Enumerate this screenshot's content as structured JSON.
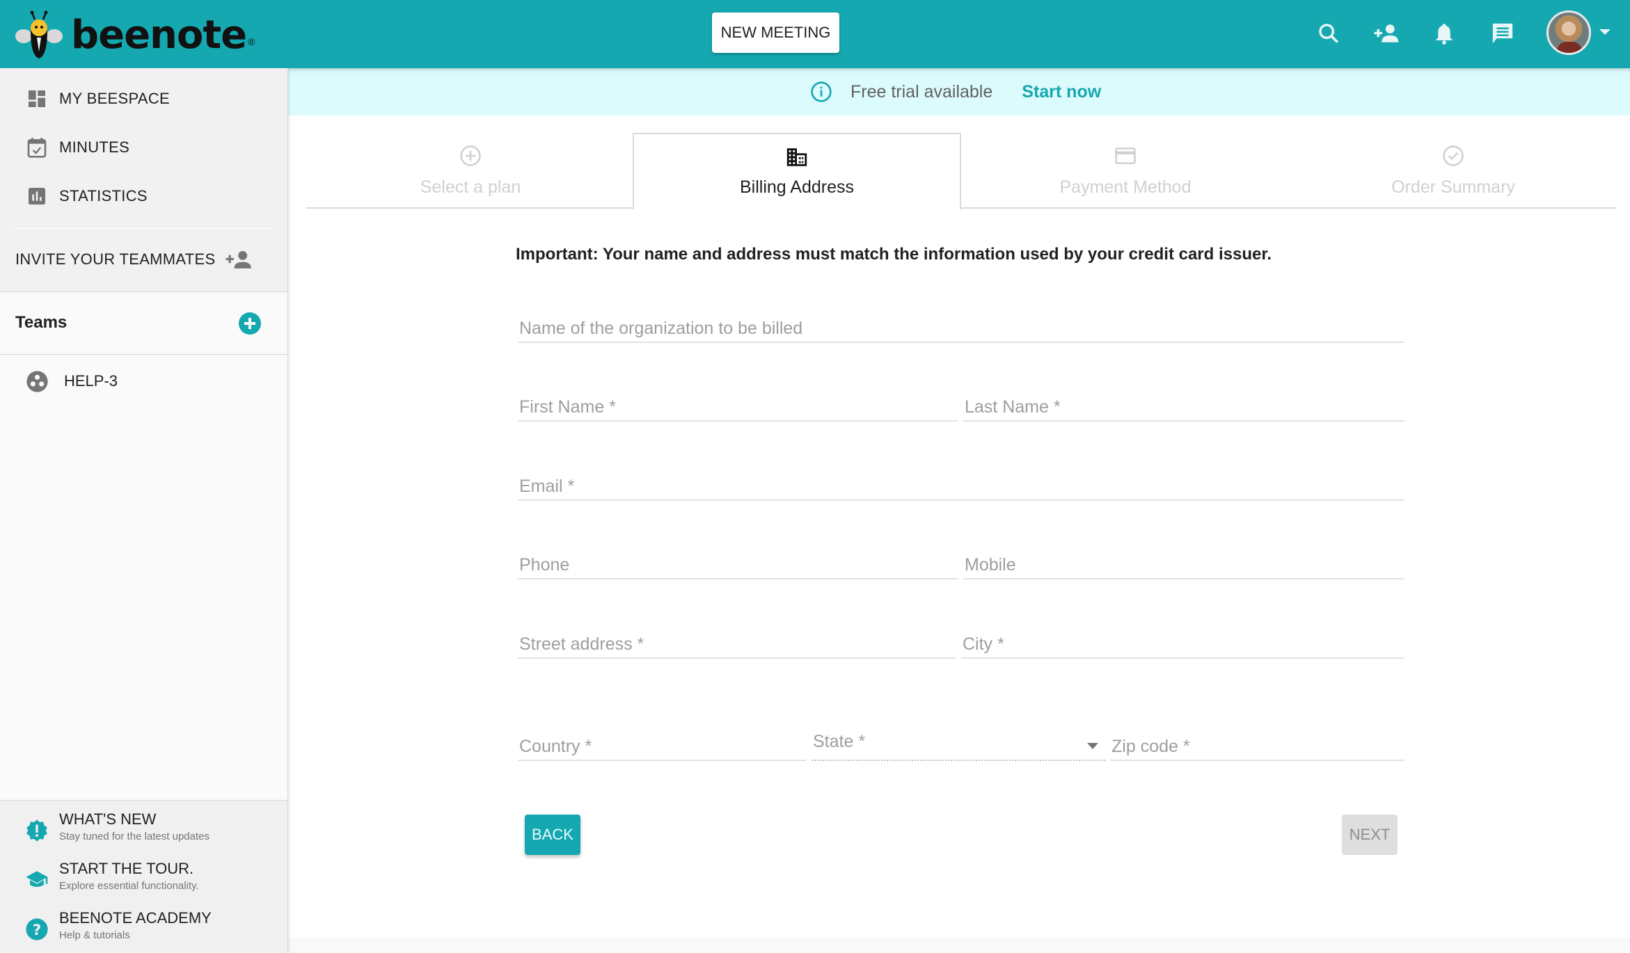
{
  "app": {
    "name": "beenote",
    "brand_color": "#15a8b0"
  },
  "header": {
    "new_meeting_label": "NEW MEETING",
    "icons": [
      "search-icon",
      "add-user-icon",
      "bell-icon",
      "chat-icon"
    ],
    "avatar_alt": "User avatar"
  },
  "sidebar": {
    "items": [
      {
        "label": "MY BEESPACE",
        "icon": "dashboard-icon"
      },
      {
        "label": "MINUTES",
        "icon": "calendar-check-icon"
      },
      {
        "label": "STATISTICS",
        "icon": "bar-chart-icon"
      }
    ],
    "invite_label": "INVITE YOUR TEAMMATES",
    "teams_title": "Teams",
    "teams": [
      {
        "label": "HELP-3",
        "icon": "team-icon"
      }
    ],
    "help": [
      {
        "title": "WHAT'S NEW",
        "subtitle": "Stay tuned for the latest updates",
        "icon": "new-badge-icon"
      },
      {
        "title": "START THE TOUR.",
        "subtitle": "Explore essential functionality.",
        "icon": "graduation-cap-icon"
      },
      {
        "title": "BEENOTE ACADEMY",
        "subtitle": "Help & tutorials",
        "icon": "help-circle-icon"
      }
    ]
  },
  "banner": {
    "text": "Free trial available",
    "link": "Start now"
  },
  "stepper": {
    "active_index": 1,
    "tabs": [
      {
        "label": "Select a plan",
        "icon": "plus-circle-icon"
      },
      {
        "label": "Billing Address",
        "icon": "building-icon"
      },
      {
        "label": "Payment Method",
        "icon": "credit-card-icon"
      },
      {
        "label": "Order Summary",
        "icon": "check-circle-icon"
      }
    ]
  },
  "form": {
    "notice": "Important: Your name and address must match the information used by your credit card issuer.",
    "fields": {
      "organization": {
        "placeholder": "Name of the organization to be billed",
        "value": ""
      },
      "first_name": {
        "placeholder": "First Name *",
        "value": ""
      },
      "last_name": {
        "placeholder": "Last Name *",
        "value": ""
      },
      "email": {
        "placeholder": "Email *",
        "value": ""
      },
      "phone": {
        "placeholder": "Phone",
        "value": ""
      },
      "mobile": {
        "placeholder": "Mobile",
        "value": ""
      },
      "street": {
        "placeholder": "Street address *",
        "value": ""
      },
      "city": {
        "placeholder": "City *",
        "value": ""
      },
      "country": {
        "placeholder": "Country *",
        "value": ""
      },
      "state": {
        "label": "State *",
        "value": ""
      },
      "zip": {
        "placeholder": "Zip code *",
        "value": ""
      }
    },
    "back_label": "BACK",
    "next_label": "NEXT"
  }
}
